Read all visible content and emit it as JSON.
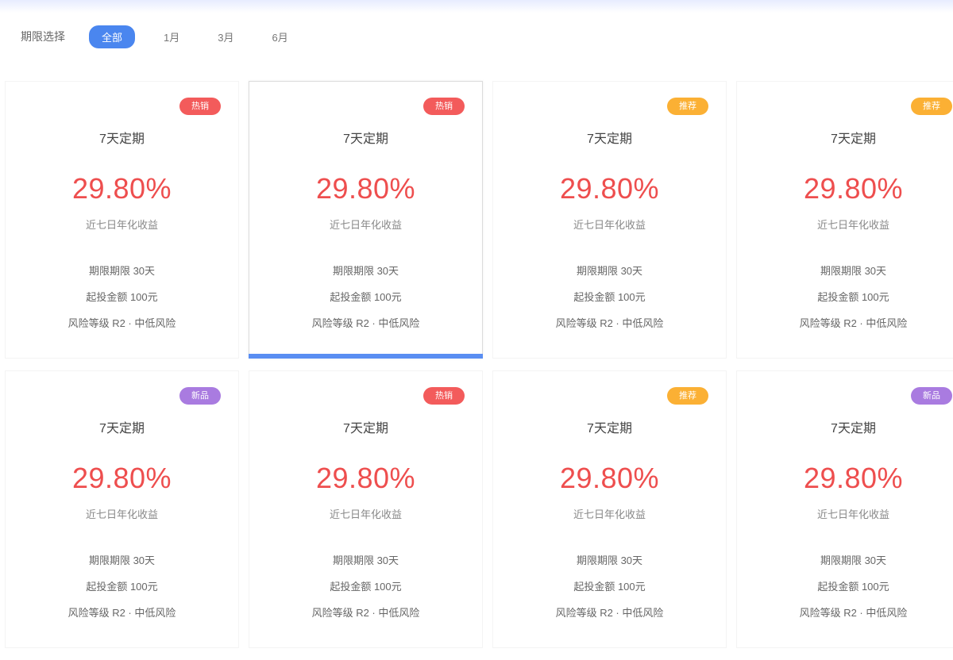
{
  "filter": {
    "label": "期限选择",
    "tabs": [
      "全部",
      "1月",
      "3月",
      "6月"
    ]
  },
  "colors": {
    "accent": "#4a86ef",
    "rate": "#ee4e4e",
    "badge_red": "#f35b5b",
    "badge_orange": "#fbb034",
    "badge_purple": "#a97be0"
  },
  "cards": [
    {
      "badge": "热销",
      "badge_color": "#f35b5b",
      "title": "7天定期",
      "rate": "29.80%",
      "rate_label": "近七日年化收益",
      "line1": "期限期限 30天",
      "line2": "起投金额 100元",
      "line3": "风险等级 R2 · 中低风险"
    },
    {
      "badge": "热销",
      "badge_color": "#f35b5b",
      "title": "7天定期",
      "rate": "29.80%",
      "rate_label": "近七日年化收益",
      "line1": "期限期限 30天",
      "line2": "起投金额 100元",
      "line3": "风险等级 R2 · 中低风险"
    },
    {
      "badge": "推荐",
      "badge_color": "#fbb034",
      "title": "7天定期",
      "rate": "29.80%",
      "rate_label": "近七日年化收益",
      "line1": "期限期限 30天",
      "line2": "起投金额 100元",
      "line3": "风险等级 R2 · 中低风险"
    },
    {
      "badge": "推荐",
      "badge_color": "#fbb034",
      "title": "7天定期",
      "rate": "29.80%",
      "rate_label": "近七日年化收益",
      "line1": "期限期限 30天",
      "line2": "起投金额 100元",
      "line3": "风险等级 R2 · 中低风险"
    },
    {
      "badge": "新品",
      "badge_color": "#a97be0",
      "title": "7天定期",
      "rate": "29.80%",
      "rate_label": "近七日年化收益",
      "line1": "期限期限 30天",
      "line2": "起投金额 100元",
      "line3": "风险等级 R2 · 中低风险"
    },
    {
      "badge": "热销",
      "badge_color": "#f35b5b",
      "title": "7天定期",
      "rate": "29.80%",
      "rate_label": "近七日年化收益",
      "line1": "期限期限 30天",
      "line2": "起投金额 100元",
      "line3": "风险等级 R2 · 中低风险"
    },
    {
      "badge": "推荐",
      "badge_color": "#fbb034",
      "title": "7天定期",
      "rate": "29.80%",
      "rate_label": "近七日年化收益",
      "line1": "期限期限 30天",
      "line2": "起投金额 100元",
      "line3": "风险等级 R2 · 中低风险"
    },
    {
      "badge": "新品",
      "badge_color": "#a97be0",
      "title": "7天定期",
      "rate": "29.80%",
      "rate_label": "近七日年化收益",
      "line1": "期限期限 30天",
      "line2": "起投金额 100元",
      "line3": "风险等级 R2 · 中低风险"
    }
  ]
}
